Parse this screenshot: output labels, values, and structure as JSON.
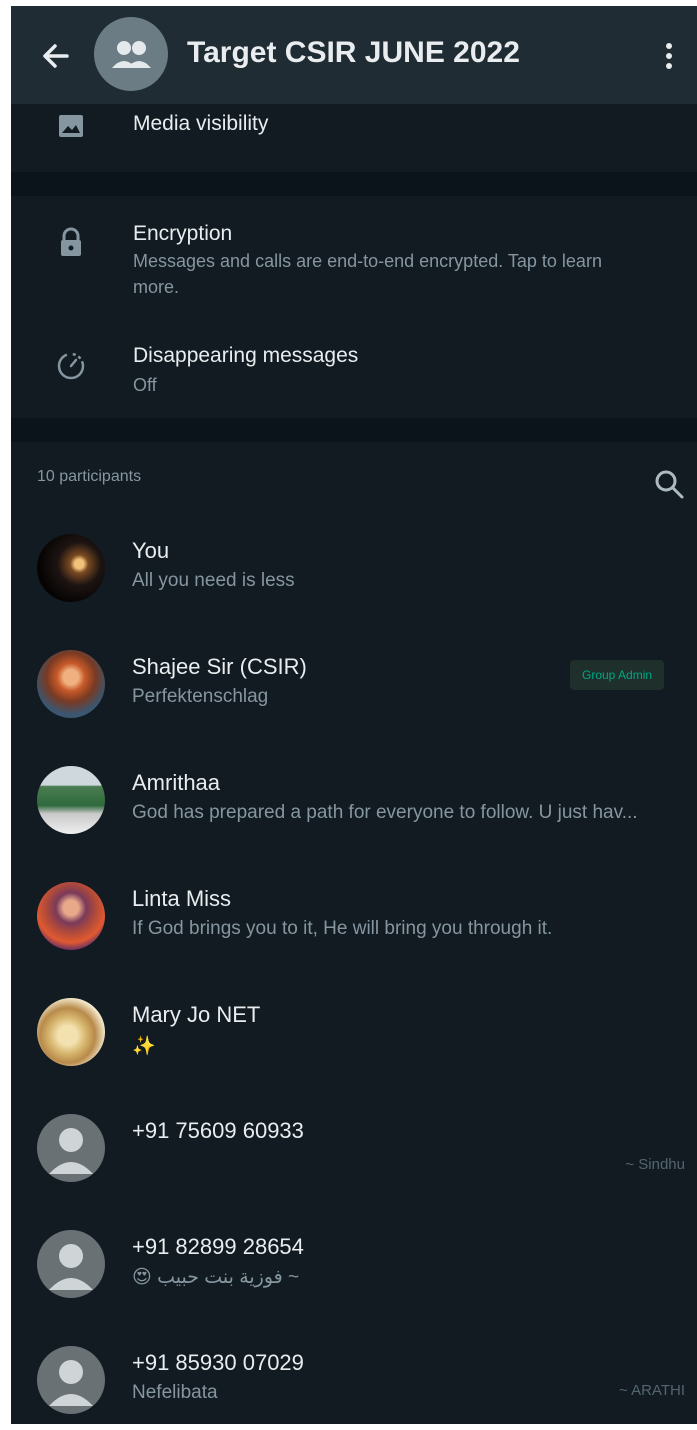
{
  "header": {
    "title": "Target CSIR JUNE 2022"
  },
  "settings": {
    "media_visibility": "Media visibility",
    "encryption_title": "Encryption",
    "encryption_desc": "Messages and calls are end-to-end encrypted. Tap to learn more.",
    "disappearing_title": "Disappearing messages",
    "disappearing_value": "Off"
  },
  "participants": {
    "count_label": "10 participants",
    "members": [
      {
        "name": "You",
        "status": "All you need is less",
        "badge": "",
        "pushname": ""
      },
      {
        "name": "Shajee Sir (CSIR)",
        "status": "Perfektenschlag",
        "badge": "Group Admin",
        "pushname": ""
      },
      {
        "name": "Amrithaa",
        "status": "God has prepared a path for everyone to follow. U just hav...",
        "badge": "",
        "pushname": ""
      },
      {
        "name": "Linta Miss",
        "status": "If God brings you to it, He will bring you through it.",
        "badge": "",
        "pushname": ""
      },
      {
        "name": "Mary Jo NET",
        "status": "✨",
        "badge": "",
        "pushname": ""
      },
      {
        "name": "+91 75609 60933",
        "status": "",
        "badge": "",
        "pushname": "~ Sindhu"
      },
      {
        "name": "+91 82899 28654",
        "status": "😍 فوزية بنت حبيب ~",
        "badge": "",
        "pushname": ""
      },
      {
        "name": "+91 85930 07029",
        "status": "Nefelibata",
        "badge": "",
        "pushname": "~ ARATHI"
      }
    ]
  },
  "colors": {
    "background": "#111b21",
    "header": "#1f2c33",
    "accent": "#00a884",
    "primary_text": "#e9edef",
    "secondary_text": "#8696a0"
  }
}
